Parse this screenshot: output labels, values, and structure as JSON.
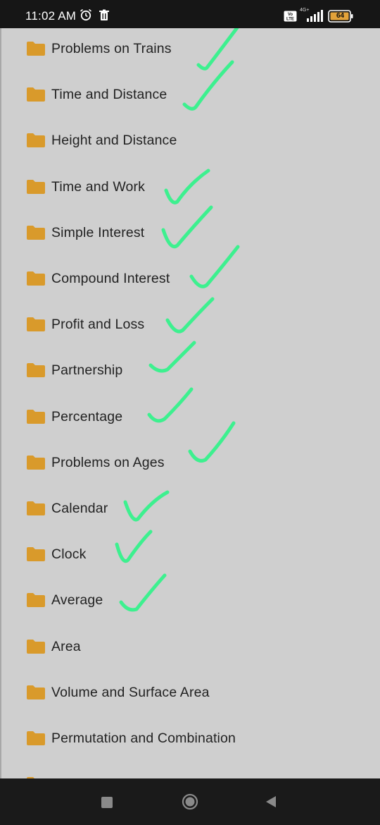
{
  "status_bar": {
    "time": "11:02 AM",
    "network_type": "4G+",
    "volte_label": "Vo LTE",
    "battery_level": "64",
    "icons": [
      "alarm-icon",
      "trash-icon",
      "volte-icon",
      "signal-icon",
      "battery-icon"
    ]
  },
  "folders": [
    {
      "label": "Problems on Trains",
      "checked": true
    },
    {
      "label": "Time and Distance",
      "checked": true
    },
    {
      "label": "Height and Distance",
      "checked": false
    },
    {
      "label": "Time and Work",
      "checked": true
    },
    {
      "label": "Simple Interest",
      "checked": true
    },
    {
      "label": "Compound Interest",
      "checked": true
    },
    {
      "label": "Profit and Loss",
      "checked": true
    },
    {
      "label": "Partnership",
      "checked": true
    },
    {
      "label": "Percentage",
      "checked": true
    },
    {
      "label": "Problems on Ages",
      "checked": true
    },
    {
      "label": "Calendar",
      "checked": true
    },
    {
      "label": "Clock",
      "checked": true
    },
    {
      "label": "Average",
      "checked": true
    },
    {
      "label": "Area",
      "checked": false
    },
    {
      "label": "Volume and Surface Area",
      "checked": false
    },
    {
      "label": "Permutation and Combination",
      "checked": false
    },
    {
      "label": "Numbers",
      "checked": false
    }
  ],
  "colors": {
    "folder": "#d99a2b",
    "checkmark": "#3df08f",
    "background": "#cfcfcf"
  },
  "nav_bar": {
    "icons": [
      "recents-button",
      "home-button",
      "back-button"
    ]
  }
}
